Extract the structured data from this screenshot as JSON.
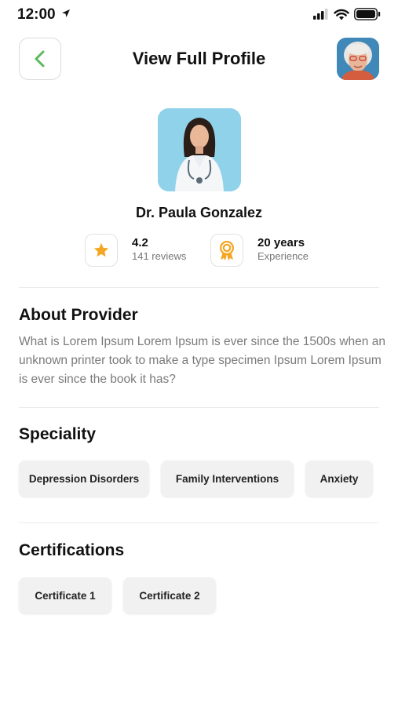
{
  "status_bar": {
    "time": "12:00",
    "icons": [
      "location-arrow-icon",
      "cellular-signal-icon",
      "wifi-icon",
      "battery-icon"
    ]
  },
  "header": {
    "title": "View Full Profile",
    "back_icon": "chevron-left-icon",
    "avatar": "user-avatar"
  },
  "provider": {
    "name": "Dr. Paula Gonzalez",
    "rating": "4.2",
    "reviews": "141 reviews",
    "experience_value": "20 years",
    "experience_label": "Experience"
  },
  "about": {
    "title": "About Provider",
    "text": "What is Lorem Ipsum Lorem Ipsum is  ever since the 1500s when an unknown printer took to make a type specimen Ipsum Lorem Ipsum is  ever since the book it has?"
  },
  "speciality": {
    "title": "Speciality",
    "items": [
      "Depression Disorders",
      "Family Interventions",
      "Anxiety"
    ]
  },
  "certifications": {
    "title": "Certifications",
    "items": [
      "Certificate 1",
      "Certificate 2"
    ]
  },
  "colors": {
    "accent_green": "#5cb85c",
    "star_orange": "#f5a623",
    "text_grey": "#7a7a7a",
    "chip_bg": "#f1f1f1"
  }
}
